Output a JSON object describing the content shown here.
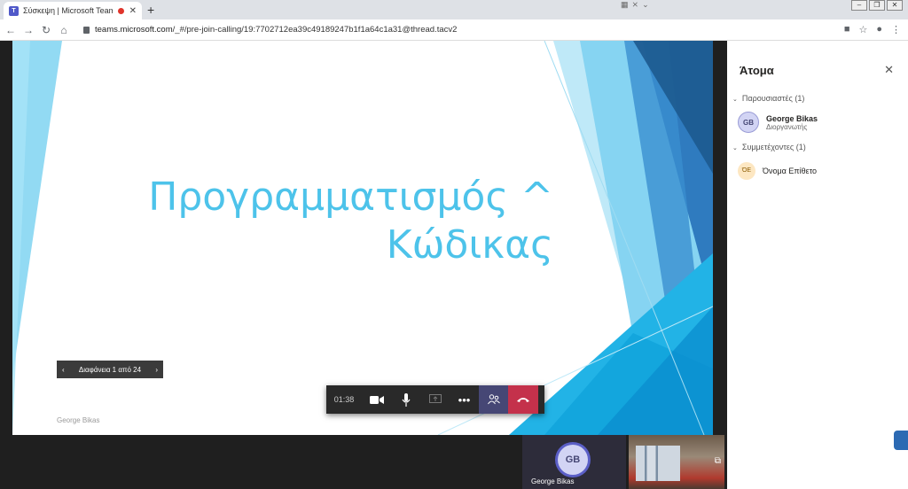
{
  "browser": {
    "tab_title": "Σύσκεψη | Microsoft Teams",
    "new_tab": "+",
    "url_domain": "teams.microsoft.com",
    "url_path": "/_#/pre-join-calling/19:7702712ea39c49189247b1f1a64c1a31@thread.tacv2"
  },
  "slide": {
    "title_line1": "Προγραμματισμός ^",
    "title_line2": "Κώδικας",
    "footer": "George Bikas",
    "nav_label": "Διαφάνεια 1 από 24",
    "accent": "#4dc3ea"
  },
  "callbar": {
    "timer": "01:38"
  },
  "tiles": {
    "me_initials": "GB",
    "me_name": "George Bikas"
  },
  "people": {
    "title": "Άτομα",
    "presenters_label": "Παρουσιαστές (1)",
    "presenter_name": "George Bikas",
    "presenter_initials": "GB",
    "presenter_role": "Διοργανωτής",
    "attendees_label": "Συμμετέχοντες (1)",
    "attendee_initials": "ΌΕ",
    "attendee_name": "Όνομα Επίθετο"
  }
}
